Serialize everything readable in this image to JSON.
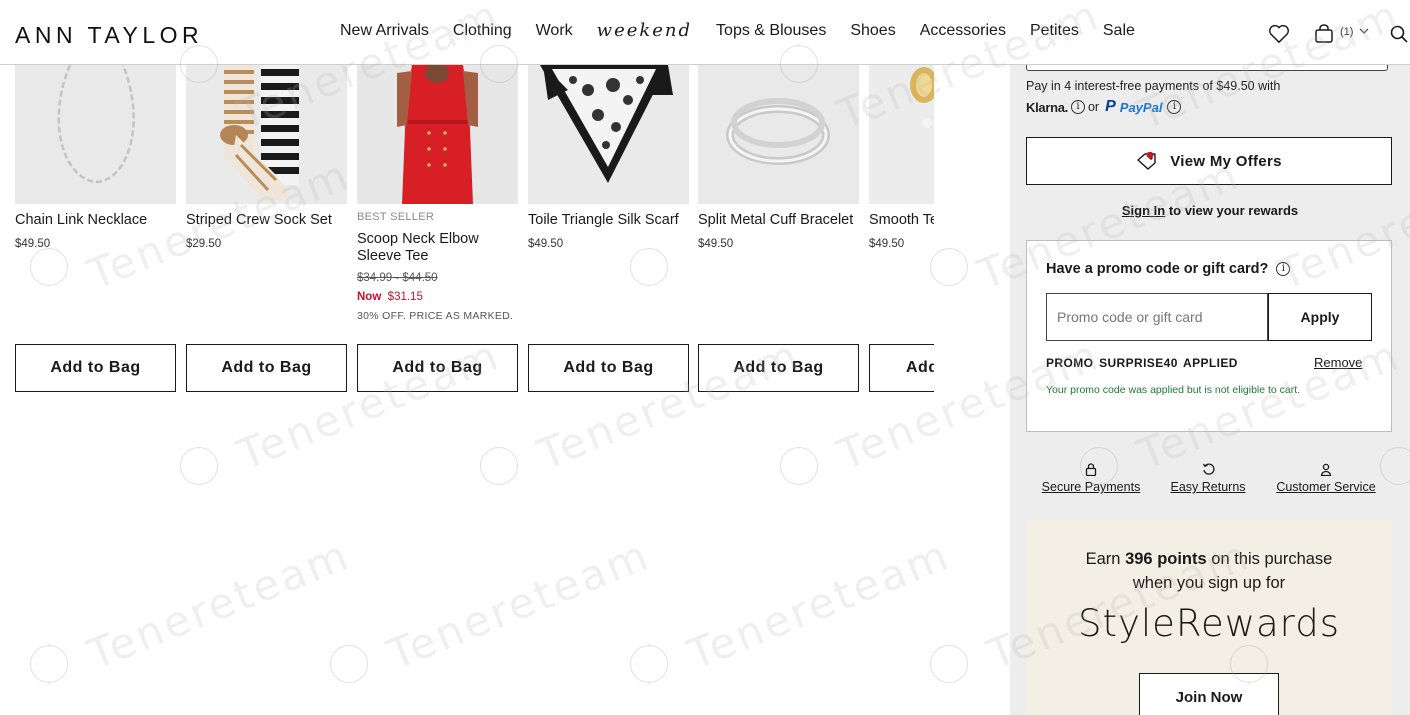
{
  "header": {
    "logo": "ANN TAYLOR",
    "nav": [
      {
        "label": "New Arrivals"
      },
      {
        "label": "Clothing"
      },
      {
        "label": "Work"
      },
      {
        "label": "weekend"
      },
      {
        "label": "Tops & Blouses"
      },
      {
        "label": "Shoes"
      },
      {
        "label": "Accessories"
      },
      {
        "label": "Petites"
      },
      {
        "label": "Sale"
      }
    ],
    "bag_count": "(1)",
    "icons": [
      "heart-icon",
      "bag-icon",
      "chevron-down-icon",
      "search-icon"
    ]
  },
  "products": [
    {
      "name": "Chain Link Necklace",
      "price": "$49.50",
      "add_label": "Add to Bag"
    },
    {
      "name": "Striped Crew Sock Set",
      "price": "$29.50",
      "add_label": "Add to Bag"
    },
    {
      "badge": "BEST SELLER",
      "name": "Scoop Neck Elbow Sleeve Tee",
      "price_original": "$34.99 - $44.50",
      "price_now_label": "Now",
      "price_now": "$31.15",
      "promo_note": "30% OFF. PRICE AS MARKED.",
      "add_label": "Add to Bag"
    },
    {
      "name": "Toile Triangle Silk Scarf",
      "price": "$49.50",
      "add_label": "Add to Bag"
    },
    {
      "name": "Split Metal Cuff Bracelet",
      "price": "$49.50",
      "add_label": "Add to Bag"
    },
    {
      "name": "Smooth Te Earrings",
      "price": "$49.50",
      "add_label": "Add"
    }
  ],
  "checkout": {
    "klarna_text": "Pay in 4 interest-free payments of $49.50 with",
    "klarna_logo": "Klarna.",
    "or": "or",
    "paypal": "PayPal",
    "view_offers": "View My Offers",
    "sign_in_link": "Sign In",
    "sign_in_rest": "to view your rewards",
    "promo_title": "Have a promo code or gift card?",
    "promo_placeholder": "Promo code or gift card",
    "apply": "Apply",
    "applied_text": "PROMO SURPRISE40 APPLIED",
    "remove": "Remove",
    "promo_message": "Your promo code was applied but is not eligible to cart.",
    "trust": [
      {
        "label": "Secure Payments",
        "icon": "lock-icon"
      },
      {
        "label": "Easy Returns",
        "icon": "return-icon"
      },
      {
        "label": "Customer Service",
        "icon": "person-icon"
      }
    ],
    "rewards": {
      "earn_prefix": "Earn",
      "points": "396 points",
      "earn_suffix": "on this purchase",
      "earn_line2": "when you sign up for",
      "program": "StyleRewards",
      "join": "Join Now"
    }
  },
  "watermark": "Tenereteam",
  "colors": {
    "sale_red": "#c8102e",
    "promo_green": "#1e7a3c",
    "panel_bg": "#ededed",
    "rewards_bg": "#f4efe5",
    "paypal_dark": "#0a3d8f",
    "paypal_light": "#1d74d6"
  }
}
